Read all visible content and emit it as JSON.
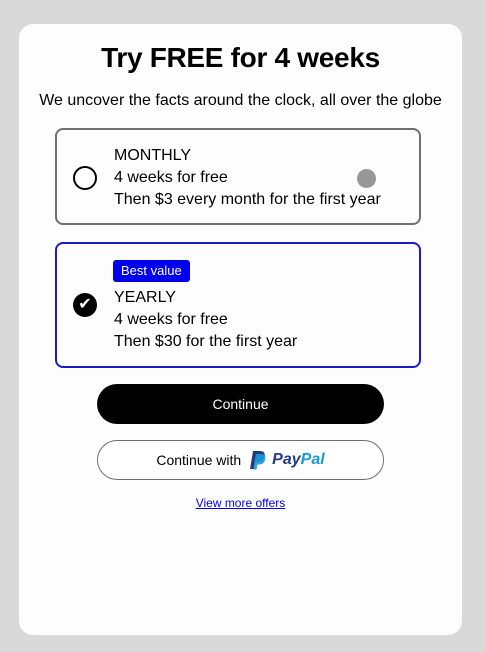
{
  "header": {
    "title": "Try FREE for 4 weeks",
    "subtitle": "We uncover the facts around the clock, all over the globe"
  },
  "plans": [
    {
      "name": "MONTHLY",
      "line1": "4 weeks for free",
      "line2": "Then $3 every month for the first year",
      "selected": false
    },
    {
      "badge": "Best value",
      "name": "YEARLY",
      "line1": "4 weeks for free",
      "line2": "Then $30 for the first year",
      "selected": true
    }
  ],
  "actions": {
    "continue_label": "Continue",
    "paypal_label": "Continue with",
    "paypal_brand_part1": "Pay",
    "paypal_brand_part2": "Pal",
    "more_offers_label": "View more offers"
  },
  "colors": {
    "accent": "#0000ee",
    "selected_border": "#1a1acc",
    "paypal_dark": "#253b80",
    "paypal_light": "#179bd7"
  }
}
